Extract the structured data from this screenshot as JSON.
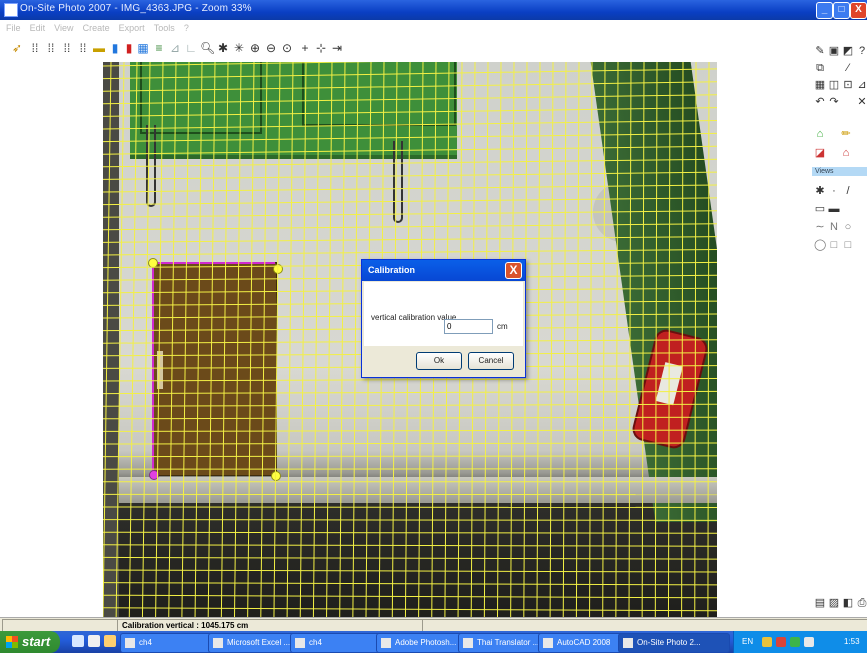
{
  "window": {
    "title": "On-Site Photo 2007 - IMG_4363.JPG - Zoom 33%",
    "min": "_",
    "max": "□",
    "close": "X"
  },
  "menu": [
    "File",
    "Edit",
    "View",
    "Create",
    "Export",
    "Tools",
    "?"
  ],
  "side_panel": {
    "views_label": "Views"
  },
  "dialog": {
    "title": "Calibration",
    "close": "X",
    "label": "vertical calibration value",
    "value": "0",
    "unit": "cm",
    "ok": "Ok",
    "cancel": "Cancel"
  },
  "status": {
    "text": "Calibration vertical : 1045.175 cm"
  },
  "taskbar": {
    "start": "start",
    "tasks": [
      {
        "label": "ch4"
      },
      {
        "label": "Microsoft Excel ..."
      },
      {
        "label": "ch4"
      },
      {
        "label": "Adobe Photosh..."
      },
      {
        "label": "Thai Translator ..."
      },
      {
        "label": "AutoCAD 2008"
      },
      {
        "label": "On-Site Photo 2..."
      }
    ],
    "tray": {
      "lang": "EN",
      "time": "1:53"
    }
  },
  "colors": {
    "grid": "#f3f045",
    "selection": "#d02ad0",
    "titlebar": "#0a3fc4"
  },
  "icons": [
    "open-icon",
    "grid-icon",
    "color-icon",
    "zoom-icon",
    "crosshair-icon",
    "select-icon"
  ]
}
